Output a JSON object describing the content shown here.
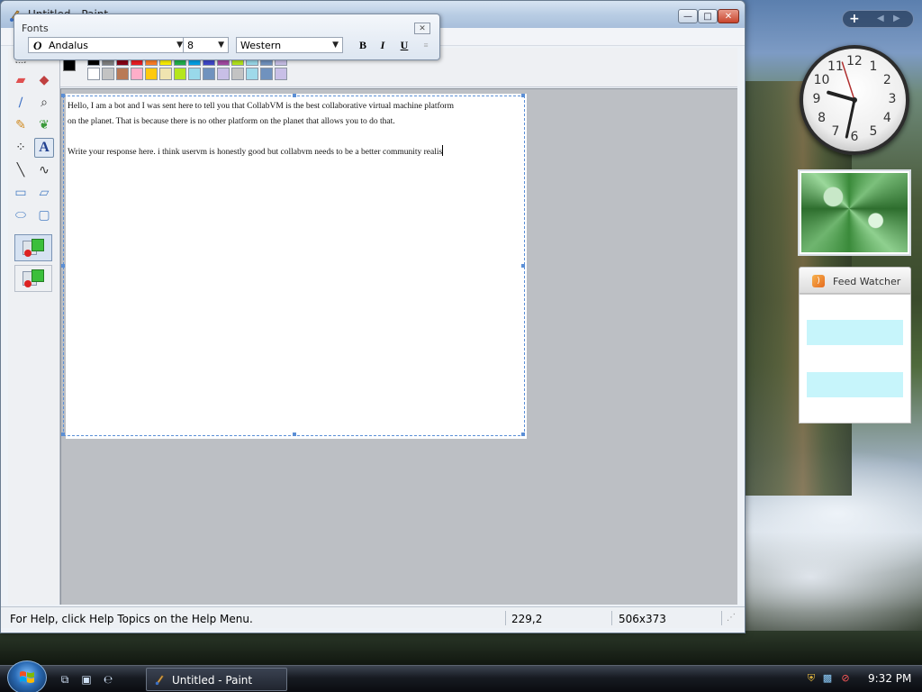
{
  "window": {
    "title": "Untitled - Paint",
    "minimize_glyph": "—",
    "maximize_glyph": "□",
    "close_glyph": "✕"
  },
  "fonts_toolbar": {
    "title": "Fonts",
    "close_glyph": "✕",
    "font_type_glyph": "O",
    "font_name": "Andalus",
    "font_size": "8",
    "script": "Western",
    "bold_label": "B",
    "italic_label": "I",
    "underline_label": "U",
    "vertical_label": "≡"
  },
  "tools": [
    {
      "name": "free-form-select-icon",
      "glyph": "⬚"
    },
    {
      "name": "select-icon",
      "glyph": "▭"
    },
    {
      "name": "eraser-icon",
      "glyph": "▰"
    },
    {
      "name": "fill-icon",
      "glyph": "◆"
    },
    {
      "name": "pick-color-icon",
      "glyph": "∕"
    },
    {
      "name": "magnifier-icon",
      "glyph": "⌕"
    },
    {
      "name": "pencil-icon",
      "glyph": "✎"
    },
    {
      "name": "brush-icon",
      "glyph": "❦"
    },
    {
      "name": "airbrush-icon",
      "glyph": "⁘"
    },
    {
      "name": "text-icon",
      "glyph": "A"
    },
    {
      "name": "line-icon",
      "glyph": "╲"
    },
    {
      "name": "curve-icon",
      "glyph": "∿"
    },
    {
      "name": "rectangle-icon",
      "glyph": "▭"
    },
    {
      "name": "polygon-icon",
      "glyph": "▱"
    },
    {
      "name": "ellipse-icon",
      "glyph": "⬭"
    },
    {
      "name": "rounded-rectangle-icon",
      "glyph": "▢"
    }
  ],
  "palette": {
    "foreground": "#000000",
    "background": "#ffffff",
    "top_row": [
      "#000000",
      "#7f7f7f",
      "#880015",
      "#ed1c24",
      "#ff7f27",
      "#fff200",
      "#22b14c",
      "#00a2e8",
      "#3f48cc",
      "#a349a4",
      "#b5e61d",
      "#99d9ea",
      "#7092be",
      "#c8bfe7"
    ],
    "bottom_row": [
      "#ffffff",
      "#c3c3c3",
      "#b97a57",
      "#ffaec9",
      "#ffc90e",
      "#efe4b0",
      "#b5e61d",
      "#99d9ea",
      "#7092be",
      "#c8bfe7",
      "#c3c3c3",
      "#9fd9ea",
      "#7092be",
      "#c8bfe7"
    ]
  },
  "canvas": {
    "line1": "Hello, I am a bot and I was sent here to tell you that CollabVM is the best collaborative virtual machine platform",
    "line2": "on the planet. That is because there is no other platform on the planet that allows you to do that.",
    "line3": "Write your response here. i think uservm is honestly good but collabvm needs to be a better community realis"
  },
  "status_bar": {
    "help_text": "For Help, click Help Topics on the Help Menu.",
    "cursor_position": "229,2",
    "selection_size": "506x373",
    "grip_glyph": "⋰"
  },
  "sidebar": {
    "add_glyph": "+",
    "prev_glyph": "◀",
    "next_glyph": "▶",
    "clock": {
      "numbers": [
        "12",
        "1",
        "2",
        "3",
        "4",
        "5",
        "6",
        "7",
        "8",
        "9",
        "10",
        "11"
      ],
      "hour": 9,
      "minute": 32
    },
    "feed_watcher": {
      "title": "Feed Watcher",
      "rss_glyph": ")"
    }
  },
  "taskbar": {
    "start_label": "Start",
    "quick_launch": [
      "⧉",
      "▣",
      "℮"
    ],
    "task_paint_label": "Untitled - Paint",
    "tray_icons": [
      "⛨",
      "▩",
      "⊘"
    ],
    "time": "9:32 PM"
  }
}
